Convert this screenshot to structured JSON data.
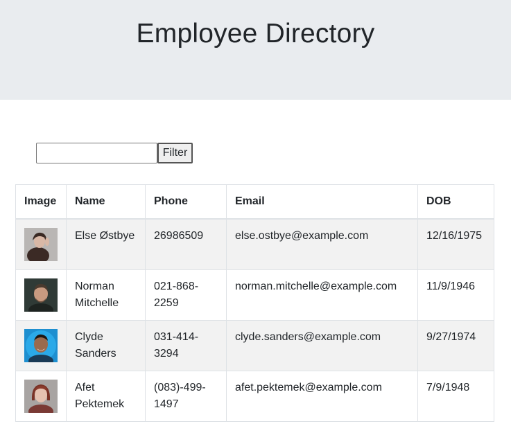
{
  "header": {
    "title": "Employee Directory"
  },
  "filter": {
    "input_value": "",
    "placeholder": "",
    "button_label": "Filter"
  },
  "table": {
    "columns": [
      "Image",
      "Name",
      "Phone",
      "Email",
      "DOB"
    ],
    "rows": [
      {
        "avatar": "portrait-photo",
        "name": "Else Østbye",
        "phone": "26986509",
        "email": "else.ostbye@example.com",
        "dob": "12/16/1975"
      },
      {
        "avatar": "portrait-photo",
        "name": "Norman Mitchelle",
        "phone": "021-868-2259",
        "email": "norman.mitchelle@example.com",
        "dob": "11/9/1946"
      },
      {
        "avatar": "portrait-photo",
        "name": "Clyde Sanders",
        "phone": "031-414-3294",
        "email": "clyde.sanders@example.com",
        "dob": "9/27/1974"
      },
      {
        "avatar": "portrait-photo",
        "name": "Afet Pektemek",
        "phone": "(083)-499-1497",
        "email": "afet.pektemek@example.com",
        "dob": "7/9/1948"
      }
    ]
  },
  "colors": {
    "header_bg": "#e9ecef",
    "row_stripe": "#f2f2f2",
    "border": "#dee2e6",
    "text": "#212529"
  }
}
